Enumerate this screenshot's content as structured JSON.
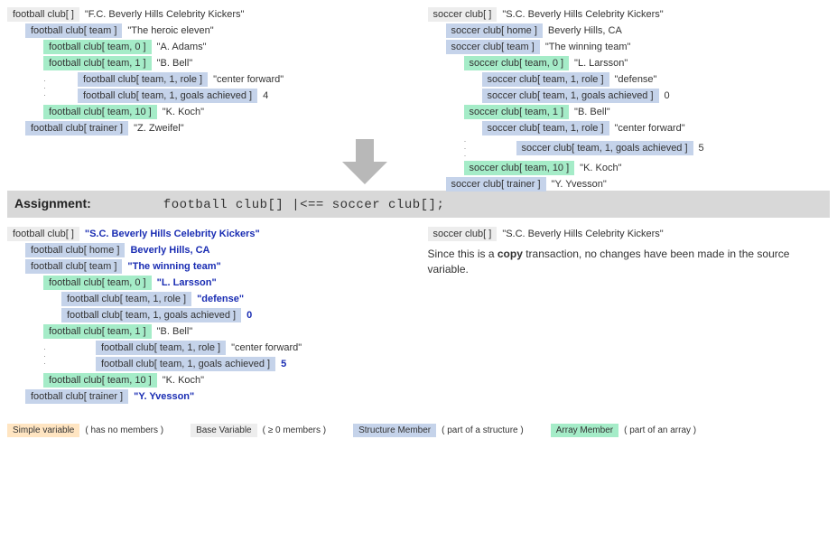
{
  "before": {
    "left": {
      "root": {
        "tag": "football club[ ]",
        "val": "\"F.C. Beverly Hills Celebrity Kickers\""
      },
      "team": {
        "tag": "football club[ team ]",
        "val": "\"The heroic eleven\""
      },
      "p0": {
        "tag": "football club[ team, 0 ]",
        "val": "\"A. Adams\""
      },
      "p1": {
        "tag": "football club[ team, 1 ]",
        "val": "\"B. Bell\""
      },
      "p1role": {
        "tag": "football club[ team, 1, role ]",
        "val": "\"center forward\""
      },
      "p1goals": {
        "tag": "football club[ team, 1, goals achieved ]",
        "val": "4"
      },
      "p10": {
        "tag": "football club[ team, 10 ]",
        "val": "\"K. Koch\""
      },
      "trainer": {
        "tag": "football club[ trainer ]",
        "val": "\"Z. Zweifel\""
      }
    },
    "right": {
      "root": {
        "tag": "soccer club[ ]",
        "val": "\"S.C. Beverly Hills Celebrity Kickers\""
      },
      "home": {
        "tag": "soccer club[ home ]",
        "val": "Beverly Hills, CA"
      },
      "team": {
        "tag": "soccer club[ team ]",
        "val": "\"The winning team\""
      },
      "p0": {
        "tag": "soccer club[ team, 0 ]",
        "val": "\"L. Larsson\""
      },
      "p0role": {
        "tag": "soccer club[ team, 1, role ]",
        "val": "\"defense\""
      },
      "p0goals": {
        "tag": "soccer club[ team, 1, goals achieved ]",
        "val": "0"
      },
      "p1": {
        "tag": "soccer club[ team, 1 ]",
        "val": "\"B. Bell\""
      },
      "p1role": {
        "tag": "soccer club[ team, 1, role ]",
        "val": "\"center forward\""
      },
      "p1goals": {
        "tag": "soccer club[ team, 1, goals achieved ]",
        "val": "5"
      },
      "p10": {
        "tag": "soccer club[ team, 10 ]",
        "val": "\"K. Koch\""
      },
      "trainer": {
        "tag": "soccer club[ trainer ]",
        "val": "\"Y. Yvesson\""
      }
    }
  },
  "assignment": {
    "label": "Assignment:",
    "code": "football club[] |<== soccer club[];"
  },
  "after": {
    "left": {
      "root": {
        "tag": "football club[ ]",
        "val": "\"S.C. Beverly Hills Celebrity Kickers\"",
        "new": true
      },
      "home": {
        "tag": "football club[ home ]",
        "val": "Beverly Hills, CA",
        "new": true
      },
      "team": {
        "tag": "football club[ team ]",
        "val": "\"The winning team\"",
        "new": true
      },
      "p0": {
        "tag": "football club[ team, 0 ]",
        "val": "\"L. Larsson\"",
        "new": true
      },
      "p0role": {
        "tag": "football club[ team, 1, role ]",
        "val": "\"defense\"",
        "new": true
      },
      "p0goals": {
        "tag": "football club[ team, 1, goals achieved ]",
        "val": "0",
        "new": true
      },
      "p1": {
        "tag": "football club[ team, 1 ]",
        "val": "\"B. Bell\""
      },
      "p1role": {
        "tag": "football club[ team, 1, role ]",
        "val": "\"center forward\""
      },
      "p1goals": {
        "tag": "football club[ team, 1, goals achieved ]",
        "val": "5",
        "new": true
      },
      "p10": {
        "tag": "football club[ team, 10 ]",
        "val": "\"K. Koch\""
      },
      "trainer": {
        "tag": "football club[ trainer ]",
        "val": "\"Y. Yvesson\"",
        "new": true
      }
    },
    "right": {
      "root": {
        "tag": "soccer club[ ]",
        "val": "\"S.C. Beverly Hills Celebrity Kickers\""
      },
      "note1": "Since this is a ",
      "noteB": "copy",
      "note2": " transaction, no changes have been made in the source variable."
    }
  },
  "legend": {
    "simple": {
      "label": "Simple variable",
      "desc": "( has no members )"
    },
    "base": {
      "label": "Base Variable",
      "desc": "( ≥ 0 members )"
    },
    "struct": {
      "label": "Structure Member",
      "desc": "( part of a structure )"
    },
    "array": {
      "label": "Array Member",
      "desc": "( part of an array )"
    }
  }
}
